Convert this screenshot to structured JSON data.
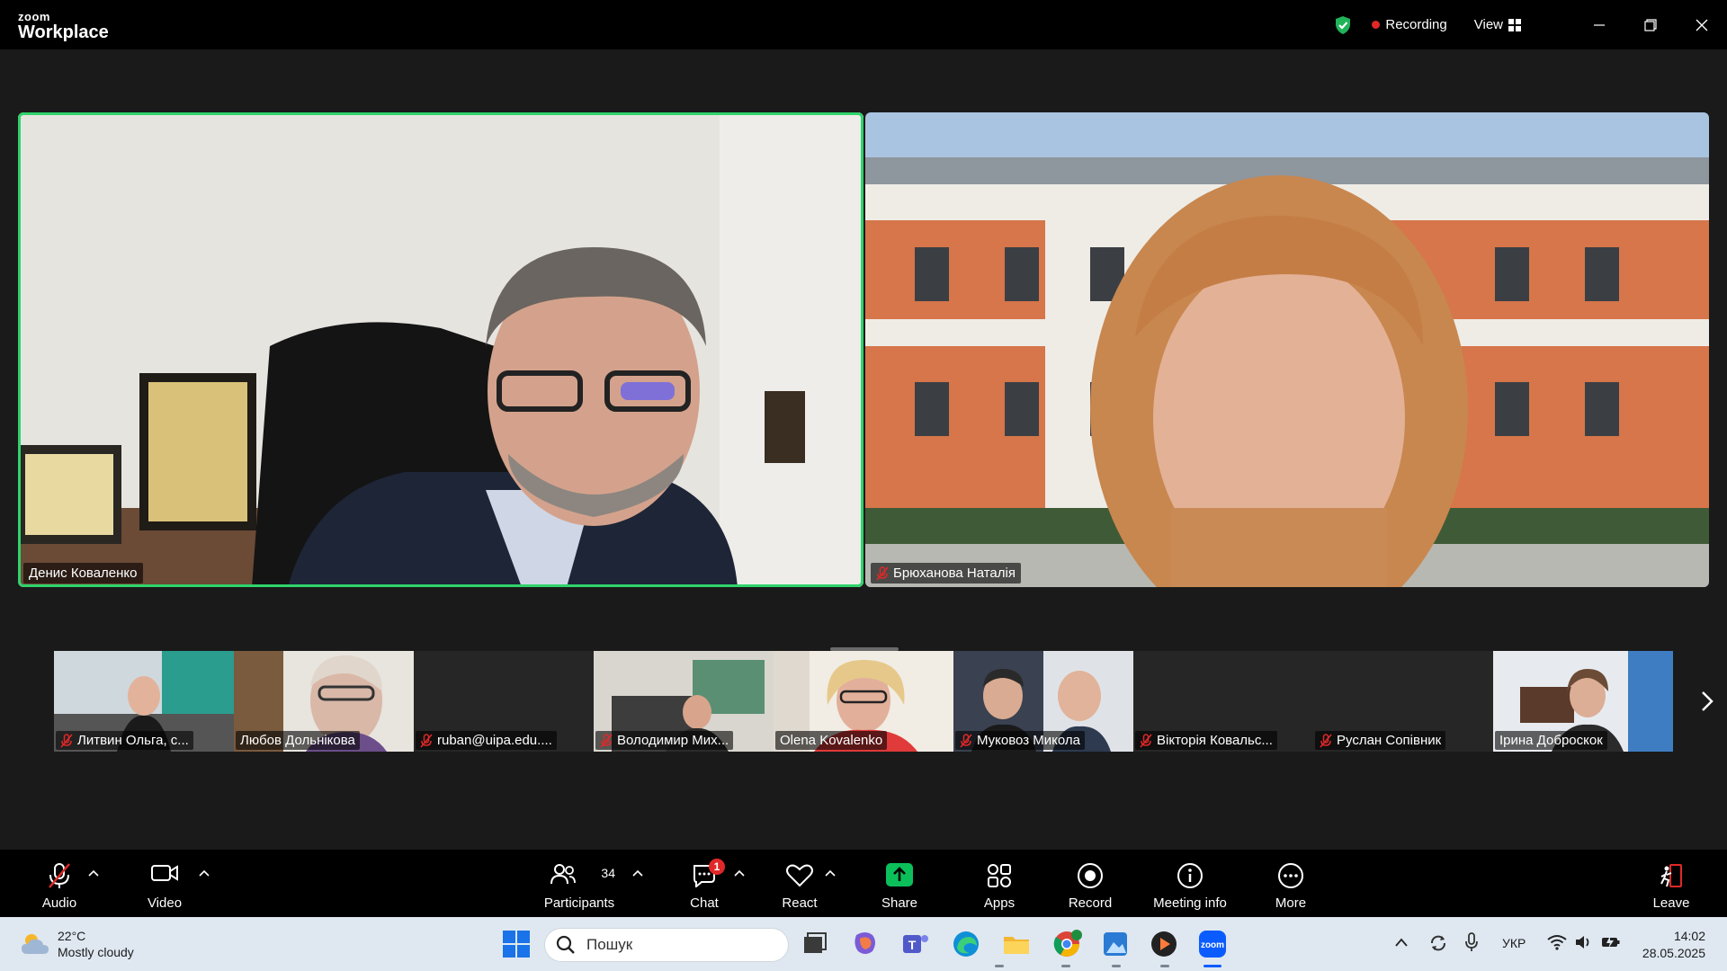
{
  "app": {
    "brand_small": "zoom",
    "brand_big": "Workplace"
  },
  "titlebar": {
    "recording_label": "Recording",
    "view_label": "View"
  },
  "main_tiles": [
    {
      "name": "Денис Коваленко",
      "muted": false,
      "active_speaker": true
    },
    {
      "name": "Брюханова Наталія",
      "muted": true,
      "active_speaker": false
    }
  ],
  "thumbnails": [
    {
      "name": "Литвин Ольга, с...",
      "muted": true
    },
    {
      "name": "Любов Дольнікова",
      "muted": false
    },
    {
      "name": "ruban@uipa.edu....",
      "muted": true
    },
    {
      "name": "Володимир Мих...",
      "muted": true
    },
    {
      "name": "Olena Kovalenko",
      "muted": false
    },
    {
      "name": "Муковоз Микола",
      "muted": true
    },
    {
      "name": "Вікторія Ковальс...",
      "muted": true
    },
    {
      "name": "Руслан Сопівник",
      "muted": true
    },
    {
      "name": "Ірина Доброскок",
      "muted": false
    }
  ],
  "toolbar": {
    "audio": "Audio",
    "video": "Video",
    "participants": "Participants",
    "participants_count": "34",
    "chat": "Chat",
    "chat_badge": "1",
    "react": "React",
    "share": "Share",
    "apps": "Apps",
    "record": "Record",
    "meeting_info": "Meeting info",
    "more": "More",
    "leave": "Leave"
  },
  "taskbar": {
    "temperature": "22°C",
    "weather": "Mostly cloudy",
    "search_placeholder": "Пошук",
    "language": "УКР",
    "time": "14:02",
    "date": "28.05.2025"
  },
  "colors": {
    "active_speaker": "#2fd36b",
    "recording": "#e02828",
    "share": "#0bbf5b",
    "badge": "#e02828"
  }
}
